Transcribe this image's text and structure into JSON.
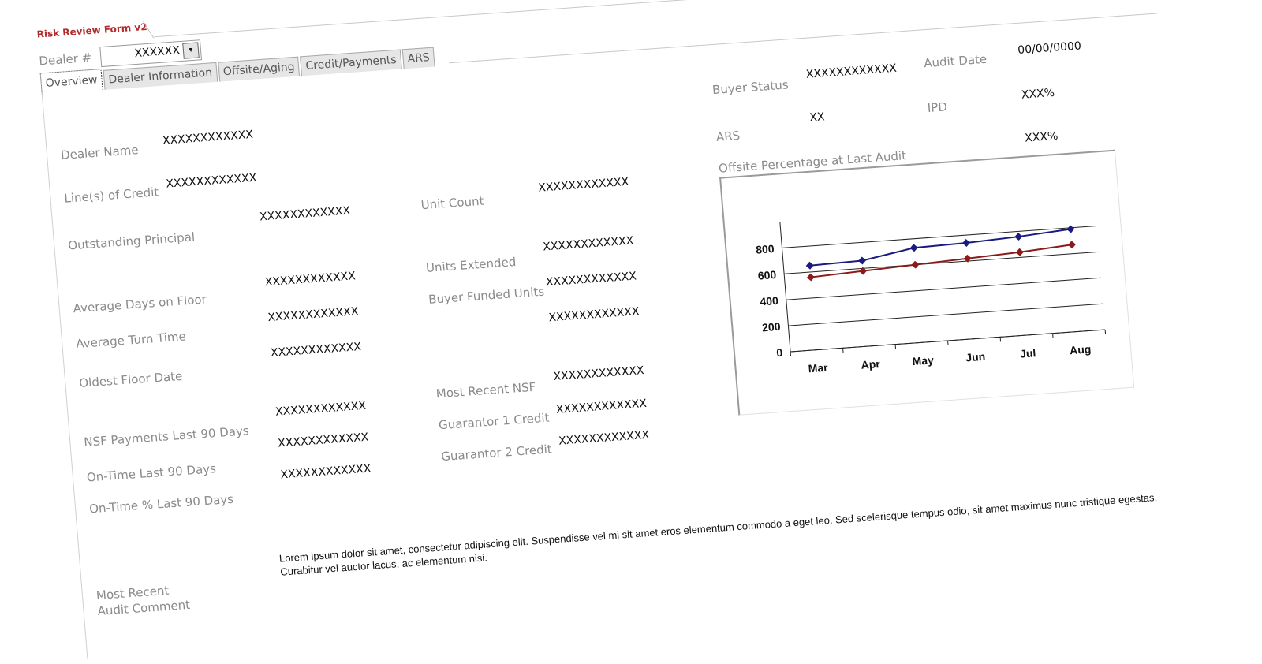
{
  "form": {
    "title": "Risk Review Form v2"
  },
  "dealer_selector": {
    "label": "Dealer #",
    "value": "XXXXXX",
    "dropdown_glyph": "▾"
  },
  "tabs": [
    {
      "label": "Overview",
      "active": true
    },
    {
      "label": "Dealer Information",
      "active": false
    },
    {
      "label": "Offsite/Aging",
      "active": false
    },
    {
      "label": "Credit/Payments",
      "active": false
    },
    {
      "label": "ARS",
      "active": false
    }
  ],
  "left_fields": {
    "dealer_name": {
      "label": "Dealer Name",
      "value": "XXXXXXXXXXXX"
    },
    "lines_of_credit": {
      "label": "Line(s) of Credit",
      "value": "XXXXXXXXXXXX"
    },
    "outstanding_principal": {
      "label": "Outstanding Principal",
      "value": "XXXXXXXXXXXX"
    },
    "average_days_on_floor": {
      "label": "Average Days on Floor",
      "value": "XXXXXXXXXXXX"
    },
    "average_turn_time": {
      "label": "Average Turn Time",
      "value": "XXXXXXXXXXXX"
    },
    "oldest_floor_date": {
      "label": "Oldest Floor Date",
      "value": "XXXXXXXXXXXX"
    },
    "nsf_payments_90": {
      "label": "NSF Payments Last 90 Days",
      "value": "XXXXXXXXXXXX"
    },
    "on_time_90": {
      "label": "On-Time Last 90 Days",
      "value": "XXXXXXXXXXXX"
    },
    "on_time_pct_90": {
      "label": "On-Time % Last 90 Days",
      "value": "XXXXXXXXXXXX"
    }
  },
  "middle_fields": {
    "unit_count": {
      "label": "Unit Count",
      "value": "XXXXXXXXXXXX"
    },
    "units_extended": {
      "label": "Units Extended",
      "value": "XXXXXXXXXXXX"
    },
    "buyer_funded_units": {
      "label": "Buyer Funded Units",
      "value": "XXXXXXXXXXXX"
    },
    "unlabeled_value": "XXXXXXXXXXXX",
    "most_recent_nsf": {
      "label": "Most Recent NSF",
      "value": "XXXXXXXXXXXX"
    },
    "guarantor_1_credit": {
      "label": "Guarantor 1 Credit",
      "value": "XXXXXXXXXXXX"
    },
    "guarantor_2_credit": {
      "label": "Guarantor 2 Credit",
      "value": "XXXXXXXXXXXX"
    }
  },
  "right_fields": {
    "buyer_status": {
      "label": "Buyer Status",
      "value": "XXXXXXXXXXXX"
    },
    "audit_date": {
      "label": "Audit Date",
      "value": "00/00/0000"
    },
    "ars": {
      "label": "ARS",
      "value": "XX"
    },
    "ipd": {
      "label": "IPD",
      "value": "XXX%"
    },
    "offsite_pct_last_audit": {
      "label": "Offsite Percentage at Last Audit",
      "value": "XXX%"
    }
  },
  "audit_comment": {
    "label_line1": "Most Recent",
    "label_line2": "Audit Comment",
    "text": "Lorem ipsum dolor sit amet, consectetur adipiscing elit. Suspendisse vel mi sit amet eros elementum commodo a eget leo. Sed scelerisque tempus odio, sit amet maximus nunc tristique egestas. Curabitur vel auctor lacus, ac elementum nisi."
  },
  "chart_data": {
    "type": "line",
    "categories": [
      "Mar",
      "Apr",
      "May",
      "Jun",
      "Jul",
      "Aug"
    ],
    "series": [
      {
        "values": [
          650,
          660,
          730,
          740,
          760,
          790
        ],
        "color": "#1a1a80"
      },
      {
        "values": [
          560,
          580,
          600,
          620,
          640,
          670
        ],
        "color": "#8b1a1a"
      }
    ],
    "ylim": [
      0,
      1000
    ],
    "yticks": [
      0,
      200,
      400,
      600,
      800
    ],
    "grid": true
  }
}
